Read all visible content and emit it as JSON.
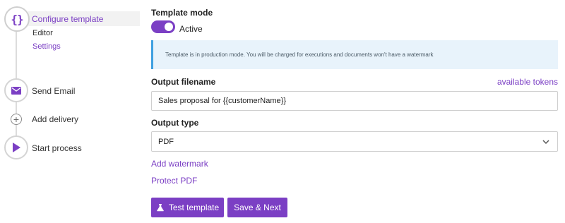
{
  "sidebar": {
    "steps": [
      {
        "label": "Configure template",
        "icon": "braces-icon",
        "active": true,
        "subitems": [
          {
            "label": "Editor"
          },
          {
            "label": "Settings"
          }
        ]
      },
      {
        "label": "Send Email",
        "icon": "envelope-icon"
      },
      {
        "label": "Add delivery",
        "icon": "plus-circle-icon"
      },
      {
        "label": "Start process",
        "icon": "play-icon"
      }
    ]
  },
  "form": {
    "template_mode": {
      "title": "Template mode",
      "toggle_on": true,
      "toggle_label": "Active"
    },
    "info_message": "Template is in production mode. You will be charged for executions and documents won't have a watermark",
    "output_filename": {
      "title": "Output filename",
      "value": "Sales proposal for {{customerName}}",
      "link": "available tokens"
    },
    "output_type": {
      "title": "Output type",
      "value": "PDF"
    },
    "add_watermark": "Add watermark",
    "protect_pdf": "Protect PDF"
  },
  "buttons": {
    "test_template": "Test template",
    "save_next": "Save & Next"
  },
  "colors": {
    "accent": "#7b3fc4",
    "info_bg": "#e8f3fb",
    "info_border": "#3fa0e0"
  }
}
